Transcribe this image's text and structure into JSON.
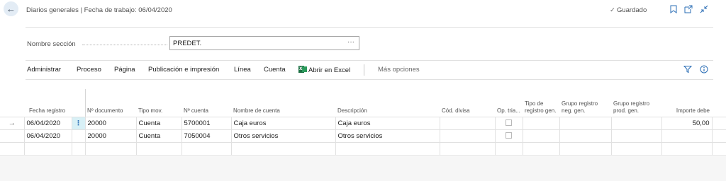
{
  "header": {
    "title": "Diarios generales | Fecha de trabajo: 06/04/2020",
    "saved_check": "✓",
    "saved_label": "Guardado"
  },
  "section": {
    "label": "Nombre sección",
    "value": "PREDET.",
    "more": "···"
  },
  "actions": {
    "items": [
      "Administrar",
      "Proceso",
      "Página",
      "Publicación e impresión",
      "Línea",
      "Cuenta"
    ],
    "open_excel": "Abrir en Excel",
    "more_options": "Más opciones"
  },
  "grid": {
    "columns": [
      "Fecha registro",
      "Nº documento",
      "Tipo mov.",
      "Nº cuenta",
      "Nombre de cuenta",
      "Descripción",
      "Cód. divisa",
      "Op. tria...",
      "Tipo de registro gen.",
      "Grupo registro neg. gen.",
      "Grupo registro prod. gen.",
      "Importe debe"
    ],
    "rows": [
      {
        "indicator": "→",
        "menu": "⋮",
        "fecha": "06/04/2020",
        "documento": "20000",
        "tipo_mov": "Cuenta",
        "cuenta": "5700001",
        "nombre_cuenta": "Caja euros",
        "descripcion": "Caja euros",
        "divisa": "",
        "tipo_registro": "",
        "grupo_neg": "",
        "grupo_prod": "",
        "importe_debe": "50,00"
      },
      {
        "indicator": "",
        "menu": "",
        "fecha": "06/04/2020",
        "documento": "20000",
        "tipo_mov": "Cuenta",
        "cuenta": "7050004",
        "nombre_cuenta": "Otros servicios",
        "descripcion": "Otros servicios",
        "divisa": "",
        "tipo_registro": "",
        "grupo_neg": "",
        "grupo_prod": "",
        "importe_debe": ""
      }
    ]
  },
  "colors": {
    "accent": "#2a6db5",
    "selected_cell": "#d8f0f6",
    "excel_green": "#1d7044"
  },
  "icons": {
    "back": "arrow-left-icon",
    "bookmark": "bookmark-icon",
    "open_new": "open-new-window-icon",
    "collapse": "collapse-icon",
    "filter": "filter-icon",
    "info": "info-icon",
    "excel": "excel-icon"
  }
}
